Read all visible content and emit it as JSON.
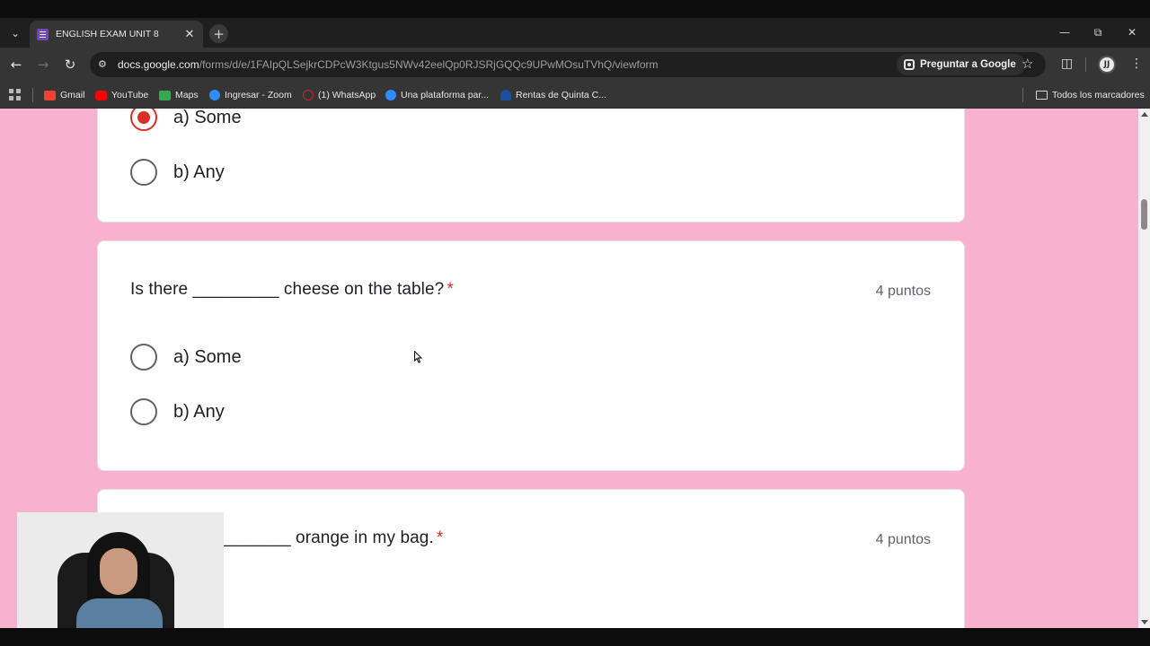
{
  "browser": {
    "tab_title": "ENGLISH EXAM UNIT 8",
    "url_host": "docs.google.com",
    "url_path": "/forms/d/e/1FAIpQLSejkrCDPcW3Ktgus5NWv42eelQp0RJSRjGQQc9UPwMOsuTVhQ/viewform",
    "ask_google": "Preguntar a Google",
    "profile_initials": "JJ",
    "bookmarks": [
      {
        "label": "Gmail",
        "color": "#ea4335"
      },
      {
        "label": "YouTube",
        "color": "#ff0000"
      },
      {
        "label": "Maps",
        "color": "#34a853"
      },
      {
        "label": "Ingresar - Zoom",
        "color": "#2d8cff"
      },
      {
        "label": "(1) WhatsApp",
        "color": "#c62828"
      },
      {
        "label": "Una plataforma par...",
        "color": "#2d8cff"
      },
      {
        "label": "Rentas de Quinta C...",
        "color": "#1a4fa3"
      }
    ],
    "all_bookmarks": "Todos los marcadores"
  },
  "form": {
    "accent_color": "#d93025",
    "background_color": "#f8b2cf",
    "prev_card": {
      "options": [
        {
          "label": "a) Some",
          "checked": true
        },
        {
          "label": "b) Any",
          "checked": false
        }
      ]
    },
    "question_card": {
      "question": "Is there _________ cheese on the table?",
      "required_mark": "*",
      "points": "4 puntos",
      "options": [
        {
          "label": "a) Some",
          "checked": false
        },
        {
          "label": "b) Any",
          "checked": false
        }
      ]
    },
    "next_card": {
      "question_partial": "_______ orange in my bag.",
      "required_mark": "*",
      "points": "4 puntos"
    }
  }
}
